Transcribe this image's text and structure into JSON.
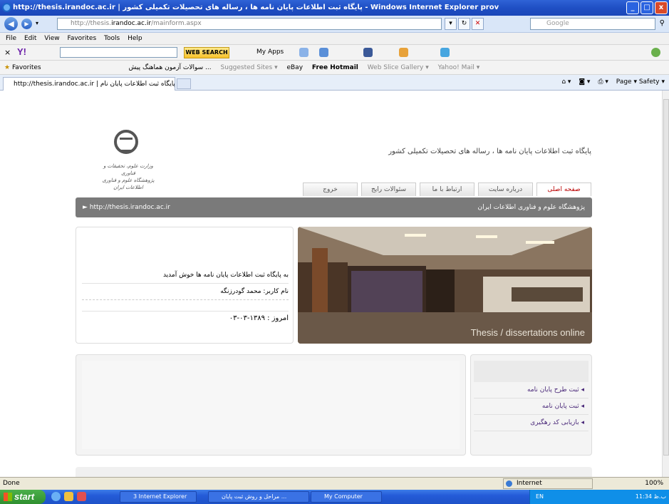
{
  "window": {
    "title": "http://thesis.irandoc.ac.ir | پایگاه ثبت اطلاعات پایان نامه ها ، رساله های تحصیلات تکمیلی کشور - Windows Internet Explorer prov",
    "minimize": "_",
    "maximize": "□",
    "close": "x"
  },
  "address": {
    "prefix": "http://thesis.",
    "domain": "irandoc.ac.ir",
    "suffix": "/mainform.aspx",
    "search_placeholder": "Google"
  },
  "menu": [
    "File",
    "Edit",
    "View",
    "Favorites",
    "Tools",
    "Help"
  ],
  "yahoo": {
    "web_search": "WEB SEARCH",
    "my_apps": "My Apps"
  },
  "favorites": {
    "label": "Favorites",
    "items": [
      "سوالات آزمون هماهنگ پیش ...",
      "Suggested Sites ▾",
      "eBay",
      "Free Hotmail",
      "Web Slice Gallery ▾",
      "Yahoo! Mail ▾"
    ]
  },
  "tab": {
    "label": "http://thesis.irandoc.ac.ir | پایگاه ثبت اطلاعات پایان نام...",
    "commands": "Page ▾   Safety ▾"
  },
  "site": {
    "title": "پایگاه ثبت اطلاعات پایان نامه ها ، رساله های تحصیلات تکمیلی کشور",
    "logo_caption_1": "وزارت علوم، تحقیقات و فناوری",
    "logo_caption_2": "پژوهشگاه علوم و فناوری اطلاعات ایران",
    "nav": [
      "صفحه اصلی",
      "درباره سایت",
      "ارتباط با ما",
      "سئوالات رایج",
      "خروج"
    ],
    "path_url": "► http://thesis.irandoc.ac.ir",
    "path_org": "پژوهشگاه علوم و فناوری اطلاعات ایران",
    "welcome": "به پایگاه ثبت اطلاعات پایان نامه ها خوش آمدید",
    "username": "نام کاربر: محمد گودرزنگه",
    "date": "امروز : ۱۳۸۹-۰۳-۰۳",
    "banner_caption": "Thesis / dissertations online",
    "links": [
      "ثبت طرح پایان نامه",
      "ثبت پایان نامه",
      "بازیابی کد رهگیری"
    ]
  },
  "status": {
    "text": "Done",
    "zone": "Internet",
    "zoom": "100%"
  },
  "taskbar": {
    "start": "start",
    "buttons": [
      "3 Internet Explorer",
      "مراحل و روش ثبت پایان ...",
      "My Computer"
    ],
    "lang": "EN",
    "clock": "11:34 ب.ظ"
  }
}
